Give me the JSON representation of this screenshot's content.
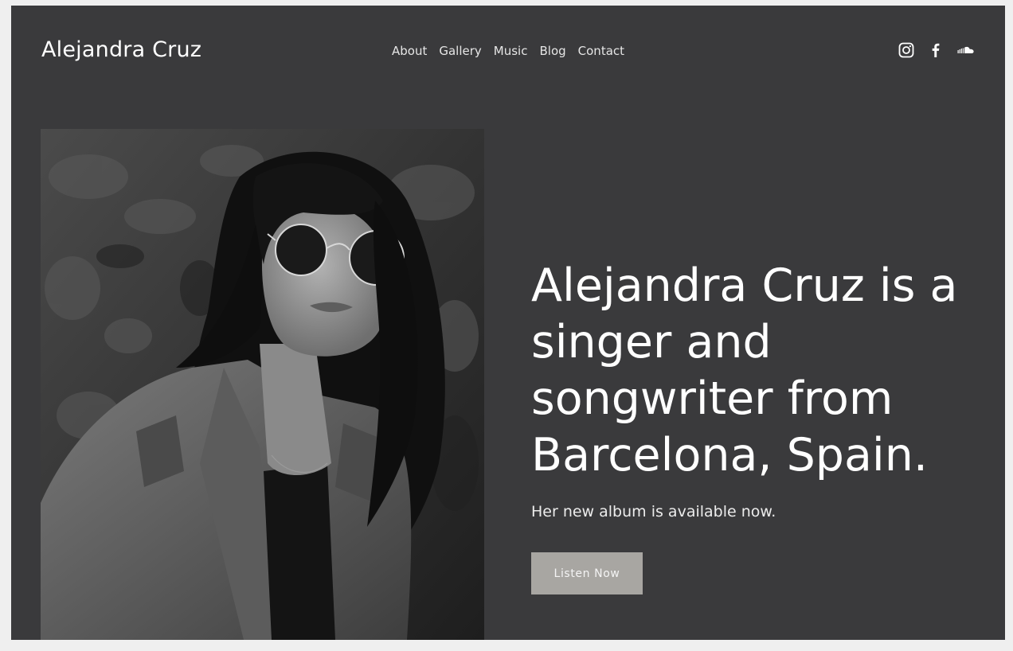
{
  "header": {
    "brand": "Alejandra Cruz",
    "nav": [
      "About",
      "Gallery",
      "Music",
      "Blog",
      "Contact"
    ],
    "social_icons": [
      "instagram-icon",
      "facebook-icon",
      "soundcloud-icon"
    ]
  },
  "hero": {
    "headline": "Alejandra Cruz is a singer and songwriter from Barcelona, Spain.",
    "subtext": "Her new album is available now.",
    "cta_label": "Listen Now"
  },
  "colors": {
    "background": "#3a3a3c",
    "text": "#ffffff",
    "button": "#a8a6a2",
    "page_frame": "#efefef"
  }
}
